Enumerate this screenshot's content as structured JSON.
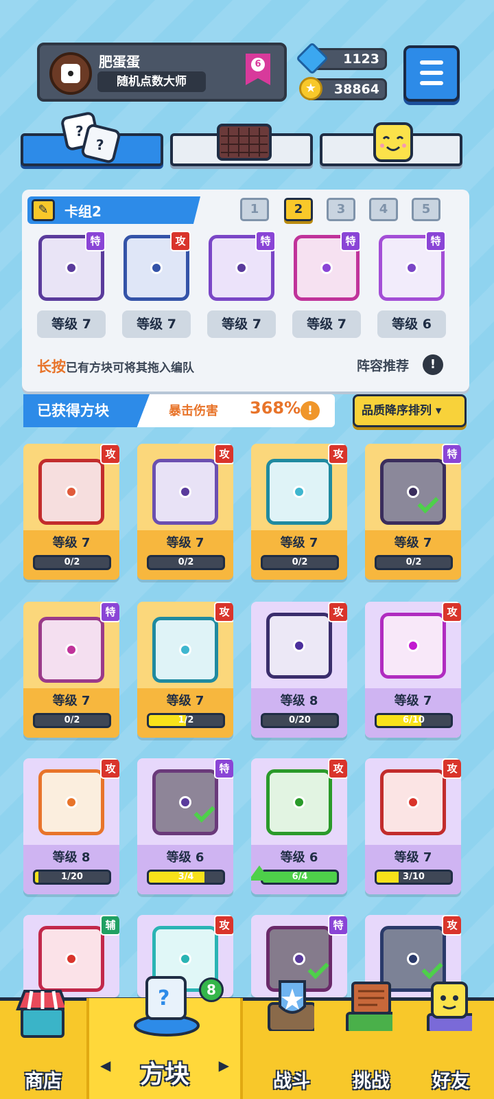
{
  "player": {
    "name": "肥蛋蛋",
    "title": "随机点数大师",
    "rank": "6"
  },
  "currency": {
    "gems": "1123",
    "coins": "38864"
  },
  "deck": {
    "title": "卡组2",
    "numbers": [
      "1",
      "2",
      "3",
      "4",
      "5"
    ],
    "active_index": 1,
    "slots": [
      {
        "tag": "特",
        "level": "等级 7"
      },
      {
        "tag": "攻",
        "level": "等级 7"
      },
      {
        "tag": "特",
        "level": "等级 7"
      },
      {
        "tag": "特",
        "level": "等级 7"
      },
      {
        "tag": "特",
        "level": "等级 6"
      }
    ],
    "hint_highlight": "长按",
    "hint_text": "已有方块可将其拖入编队",
    "recommend": "阵容推荐",
    "help": "!"
  },
  "obtained": {
    "label": "已获得方块",
    "crit_label": "暴击伤害",
    "crit_value": "368%",
    "sort_label": "品质降序排列 ▾"
  },
  "collection": [
    {
      "tag": "攻",
      "level": "等级 7",
      "progress": "0/2",
      "fill": 0,
      "rarity": "legend"
    },
    {
      "tag": "攻",
      "level": "等级 7",
      "progress": "0/2",
      "fill": 0,
      "rarity": "legend"
    },
    {
      "tag": "攻",
      "level": "等级 7",
      "progress": "0/2",
      "fill": 0,
      "rarity": "legend"
    },
    {
      "tag": "特",
      "level": "等级 7",
      "progress": "0/2",
      "fill": 0,
      "rarity": "legend"
    },
    {
      "tag": "特",
      "level": "等级 7",
      "progress": "0/2",
      "fill": 0,
      "rarity": "legend"
    },
    {
      "tag": "攻",
      "level": "等级 7",
      "progress": "1/2",
      "fill": 0.5,
      "rarity": "legend"
    },
    {
      "tag": "攻",
      "level": "等级 8",
      "progress": "0/20",
      "fill": 0,
      "rarity": "epic"
    },
    {
      "tag": "攻",
      "level": "等级 7",
      "progress": "6/10",
      "fill": 0.6,
      "rarity": "epic"
    },
    {
      "tag": "攻",
      "level": "等级 8",
      "progress": "1/20",
      "fill": 0.05,
      "rarity": "epic"
    },
    {
      "tag": "特",
      "level": "等级 6",
      "progress": "3/4",
      "fill": 0.75,
      "rarity": "epic"
    },
    {
      "tag": "攻",
      "level": "等级 6",
      "progress": "6/4",
      "fill": 1,
      "rarity": "epic"
    },
    {
      "tag": "攻",
      "level": "等级 7",
      "progress": "3/10",
      "fill": 0.3,
      "rarity": "epic"
    },
    {
      "tag": "辅",
      "rarity": "epic"
    },
    {
      "tag": "攻",
      "rarity": "epic"
    },
    {
      "tag": "特",
      "rarity": "epic"
    },
    {
      "tag": "攻",
      "rarity": "epic"
    }
  ],
  "nav": {
    "shop": "商店",
    "dice": "方块",
    "battle": "战斗",
    "challenge": "挑战",
    "friends": "好友",
    "dice_badge": "8"
  },
  "colors": {
    "primary_blue": "#2d8be8",
    "gold_card": "#fbd77b",
    "purple_card": "#e7d8fb",
    "attack_tag": "#d9342b",
    "special_tag": "#8a45d6",
    "support_tag": "#20a062",
    "nav_yellow": "#f8c82a"
  }
}
